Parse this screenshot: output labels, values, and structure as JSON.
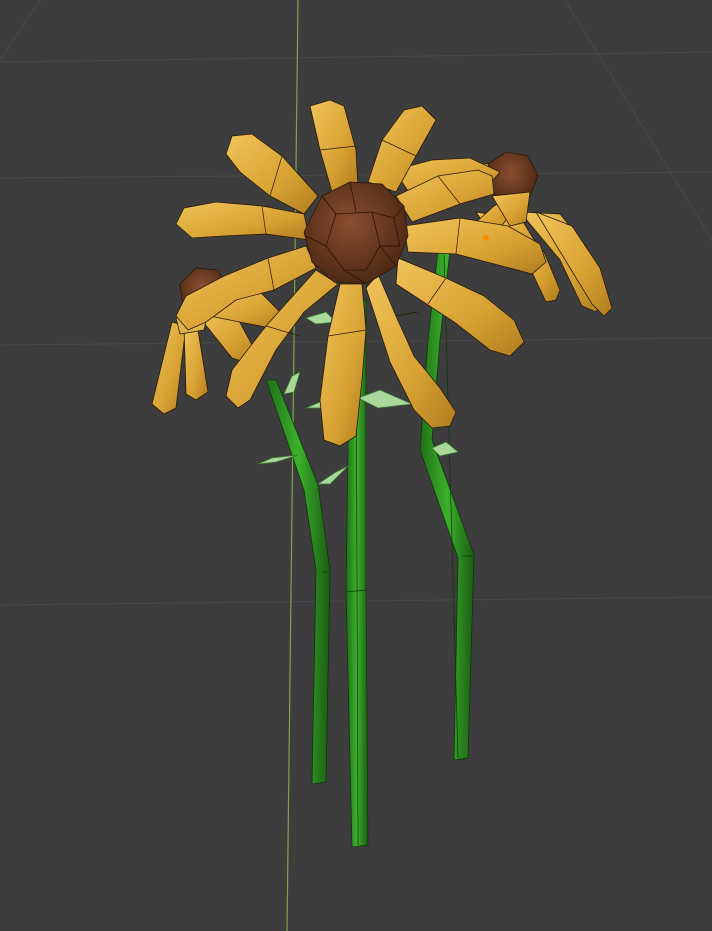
{
  "viewport": {
    "background_color": "#3d3d3d",
    "grid_color": "#4a4a4a",
    "y_axis_color": "#7fa34a"
  },
  "model": {
    "flowers": [
      {
        "name": "front-flower",
        "petal_color": "#d4a02e",
        "center_color": "#6b3a22"
      },
      {
        "name": "right-flower",
        "petal_color": "#d4a02e",
        "center_color": "#6b3a22"
      },
      {
        "name": "left-flower",
        "petal_color": "#d4a02e",
        "center_color": "#6b3a22"
      }
    ],
    "stem_color": "#2e9a22",
    "leaf_color": "#a9d89a",
    "selected_vertex_color": "#ff8c00"
  }
}
